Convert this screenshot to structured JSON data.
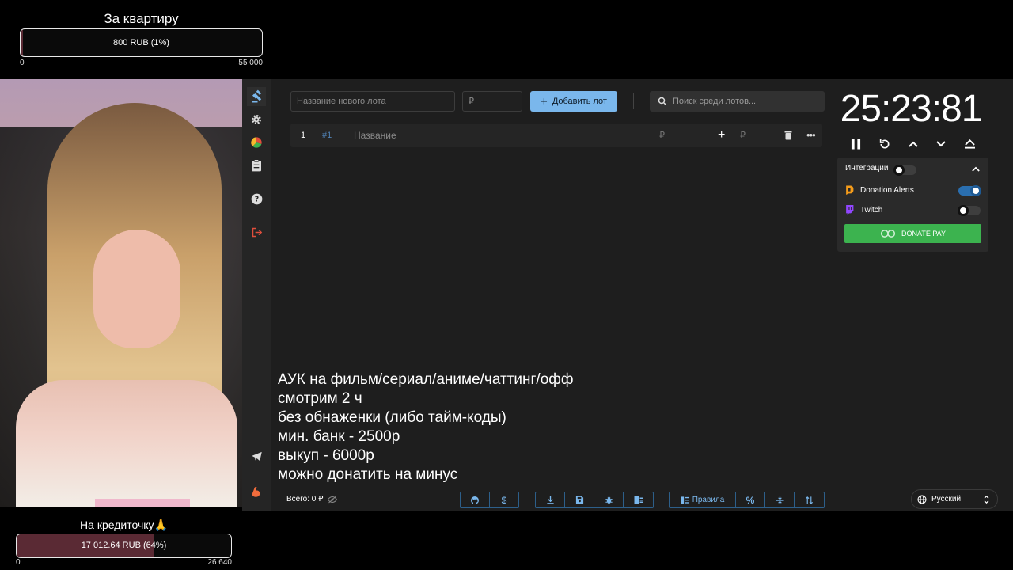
{
  "goal_top": {
    "title": "За квартиру",
    "progress_text": "800 RUB (1%)",
    "progress_fraction": 0.01,
    "min": "0",
    "max": "55 000"
  },
  "goal_bottom": {
    "title": "На кредиточку🙏",
    "progress_text": "17 012.64 RUB (64%)",
    "progress_fraction": 0.64,
    "min": "0",
    "max": "26 640"
  },
  "sidebar": {
    "items": [
      {
        "icon": "auction-hammer-icon"
      },
      {
        "icon": "gear-icon"
      },
      {
        "icon": "wheel-chart-icon"
      },
      {
        "icon": "clipboard-icon"
      },
      {
        "icon": "help-icon"
      },
      {
        "icon": "logout-icon"
      },
      {
        "icon": "telegram-icon"
      },
      {
        "icon": "boosty-icon"
      }
    ]
  },
  "toolbar": {
    "lot_name_placeholder": "Название нового лота",
    "amount_placeholder": "₽",
    "add_label": "Добавить лот",
    "search_placeholder": "Поиск среди лотов..."
  },
  "lot": {
    "index": "1",
    "id": "#1",
    "name_placeholder": "Название",
    "amount_currency": "₽",
    "add_amount_currency": "₽"
  },
  "timer": {
    "value": "25:23:81"
  },
  "integrations": {
    "title": "Интеграции",
    "items": [
      {
        "label": "Donation Alerts",
        "enabled": true,
        "color": "#f59c1a"
      },
      {
        "label": "Twitch",
        "enabled": false,
        "color": "#9146ff"
      }
    ],
    "donate_pay_label": "DONATE PAY"
  },
  "overlay_lines": [
    "АУК на фильм/сериал/аниме/чаттинг/офф",
    "смотрим 2 ч",
    "без обнаженки (либо тайм-коды)",
    "мин. банк - 2500р",
    "выкуп - 6000р",
    "можно донатить на минус"
  ],
  "footer": {
    "total": "Всего: 0 ₽",
    "rules_label": "Правила",
    "language": "Русский"
  },
  "colors": {
    "accent": "#7ab7ec",
    "donate_pay": "#3cb34f",
    "goal_fill": "#5a2a34"
  }
}
